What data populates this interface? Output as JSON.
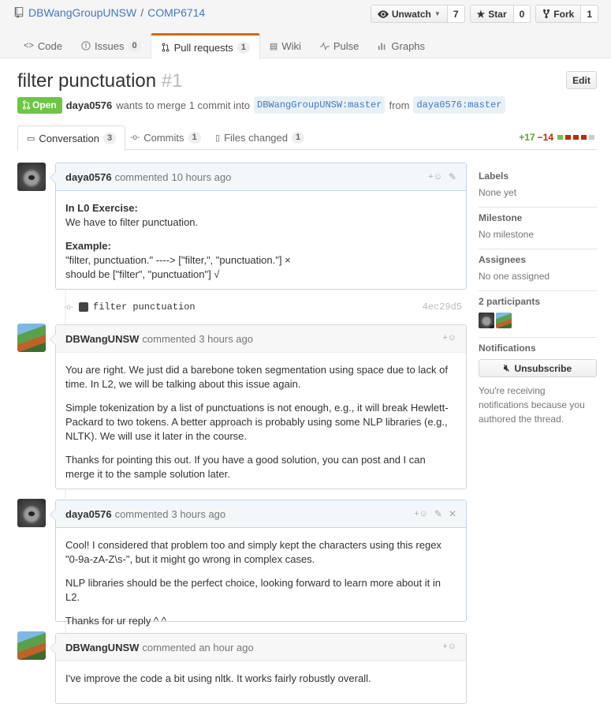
{
  "repo": {
    "owner": "DBWangGroupUNSW",
    "name": "COMP6714",
    "actions": [
      {
        "label": "Unwatch",
        "count": "7"
      },
      {
        "label": "Star",
        "count": "0"
      },
      {
        "label": "Fork",
        "count": "1"
      }
    ],
    "tabs": [
      {
        "label": "Code",
        "counter": ""
      },
      {
        "label": "Issues",
        "counter": "0"
      },
      {
        "label": "Pull requests",
        "counter": "1"
      },
      {
        "label": "Wiki",
        "counter": ""
      },
      {
        "label": "Pulse",
        "counter": ""
      },
      {
        "label": "Graphs",
        "counter": ""
      }
    ]
  },
  "pr": {
    "title": "filter punctuation",
    "number": "#1",
    "edit_label": "Edit",
    "state": "Open",
    "author": "daya0576",
    "meta_text": "wants to merge 1 commit into",
    "base_ref": "DBWangGroupUNSW:master",
    "from_text": "from",
    "head_ref": "daya0576:master",
    "tabs": [
      {
        "label": "Conversation",
        "counter": "3"
      },
      {
        "label": "Commits",
        "counter": "1"
      },
      {
        "label": "Files changed",
        "counter": "1"
      }
    ],
    "additions": "+17",
    "deletions": "−14"
  },
  "comments": [
    {
      "author": "daya0576",
      "action": "commented",
      "time": "10 hours ago",
      "paragraphs": [
        {
          "bold": "In L0 Exercise:",
          "text": "We have to filter punctuation."
        },
        {
          "bold": "Example:",
          "text": "\"filter, punctuation.\" ----> [\"filter,\", \"punctuation.\"] ×",
          "text2": "should be [\"filter\", \"punctuation\"] √"
        }
      ]
    },
    {
      "author": "DBWangUNSW",
      "action": "commented",
      "time": "3 hours ago",
      "paragraphs": [
        "You are right. We just did a barebone token segmentation using space due to lack of time. In L2, we will be talking about this issue again.",
        "Simple tokenization by a list of punctuations is not enough, e.g., it will break Hewlett-Packard to two tokens. A better approach is probably using some NLP libraries (e.g., NLTK). We will use it later in the course.",
        "Thanks for pointing this out. If you have a good solution, you can post and I can merge it to the sample solution later."
      ]
    },
    {
      "author": "daya0576",
      "action": "commented",
      "time": "3 hours ago",
      "paragraphs": [
        "Cool! I considered that problem too and simply kept the characters using this regex \"0-9a-zA-Z\\s-\", but it might go wrong in complex cases.",
        "NLP libraries should be the perfect choice, looking forward to learn more about it in L2.",
        "Thanks for ur reply ^ ^"
      ]
    },
    {
      "author": "DBWangUNSW",
      "action": "commented",
      "time": "an hour ago",
      "paragraphs": [
        "I've improve the code a bit using nltk. It works fairly robustly overall."
      ]
    }
  ],
  "commit": {
    "message": "filter punctuation",
    "sha": "4ec29d5"
  },
  "sidebar": {
    "labels_title": "Labels",
    "labels_value": "None yet",
    "milestone_title": "Milestone",
    "milestone_value": "No milestone",
    "assignees_title": "Assignees",
    "assignees_value": "No one assigned",
    "participants_title": "2 participants",
    "notifications_title": "Notifications",
    "unsubscribe_label": "Unsubscribe",
    "notification_note": "You're receiving notifications because you authored the thread."
  },
  "colors": {
    "link": "#4078c0",
    "open_state": "#6cc644",
    "tab_accent": "#d26911",
    "additions": "#55a532",
    "deletions": "#bd2c00"
  }
}
